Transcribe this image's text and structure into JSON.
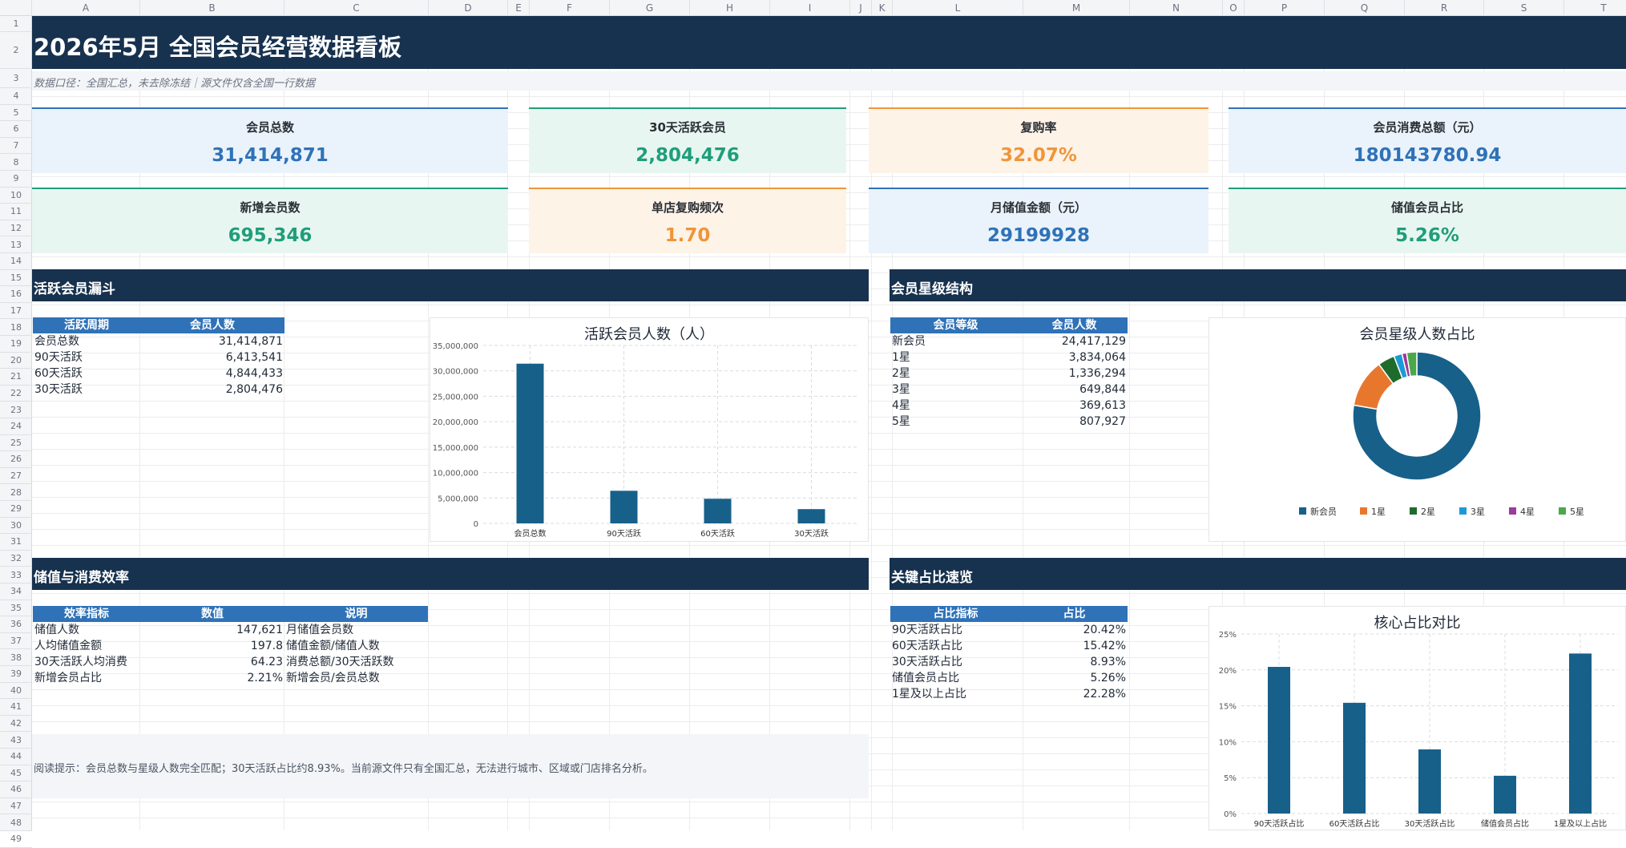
{
  "sheet": {
    "columns": [
      "A",
      "B",
      "C",
      "D",
      "E",
      "F",
      "G",
      "H",
      "I",
      "J",
      "K",
      "L",
      "M",
      "N",
      "O",
      "P",
      "Q",
      "R",
      "S",
      "T"
    ],
    "rows": [
      "1",
      "2",
      "3",
      "4",
      "5",
      "6",
      "7",
      "8",
      "9",
      "10",
      "11",
      "12",
      "13",
      "14",
      "15",
      "16",
      "17",
      "18",
      "19",
      "20",
      "21",
      "22",
      "23",
      "24",
      "25",
      "26",
      "27",
      "28",
      "29",
      "30",
      "31",
      "32",
      "33",
      "34",
      "35",
      "36",
      "37",
      "38",
      "39",
      "40",
      "41",
      "42",
      "43",
      "44",
      "45",
      "46",
      "47",
      "48",
      "49"
    ]
  },
  "title": "2026年5月 全国会员经营数据看板",
  "subtitle": "数据口径：全国汇总，未去除冻结｜源文件仅含全国一行数据",
  "kpis": [
    {
      "label": "会员总数",
      "value": "31,414,871",
      "color": "#2f72b8",
      "bg": "#eaf3fb",
      "bar": "#2f72b8"
    },
    {
      "label": "30天活跃会员",
      "value": "2,804,476",
      "color": "#1f9e7a",
      "bg": "#e8f6f1",
      "bar": "#1f9e7a"
    },
    {
      "label": "复购率",
      "value": "32.07%",
      "color": "#f0953a",
      "bg": "#fef3e7",
      "bar": "#f0953a"
    },
    {
      "label": "会员消费总额（元）",
      "value": "180143780.94",
      "color": "#2f72b8",
      "bg": "#eaf3fb",
      "bar": "#2f72b8"
    },
    {
      "label": "新增会员数",
      "value": "695,346",
      "color": "#1f9e7a",
      "bg": "#e8f6f1",
      "bar": "#1f9e7a"
    },
    {
      "label": "单店复购频次",
      "value": "1.70",
      "color": "#f0953a",
      "bg": "#fef3e7",
      "bar": "#f0953a"
    },
    {
      "label": "月储值金额（元）",
      "value": "29199928",
      "color": "#2f72b8",
      "bg": "#eaf3fb",
      "bar": "#2f72b8"
    },
    {
      "label": "储值会员占比",
      "value": "5.26%",
      "color": "#1f9e7a",
      "bg": "#e8f6f1",
      "bar": "#1f9e7a"
    }
  ],
  "sections": {
    "funnel": "活跃会员漏斗",
    "star": "会员星级结构",
    "efficiency": "储值与消费效率",
    "ratio": "关键占比速览"
  },
  "funnel_table": {
    "headers": [
      "活跃周期",
      "会员人数"
    ],
    "rows": [
      [
        "会员总数",
        "31,414,871"
      ],
      [
        "90天活跃",
        "6,413,541"
      ],
      [
        "60天活跃",
        "4,844,433"
      ],
      [
        "30天活跃",
        "2,804,476"
      ]
    ]
  },
  "star_table": {
    "headers": [
      "会员等级",
      "会员人数"
    ],
    "rows": [
      [
        "新会员",
        "24,417,129"
      ],
      [
        "1星",
        "3,834,064"
      ],
      [
        "2星",
        "1,336,294"
      ],
      [
        "3星",
        "649,844"
      ],
      [
        "4星",
        "369,613"
      ],
      [
        "5星",
        "807,927"
      ]
    ]
  },
  "eff_table": {
    "headers": [
      "效率指标",
      "数值",
      "说明"
    ],
    "rows": [
      [
        "储值人数",
        "147,621",
        "月储值会员数"
      ],
      [
        "人均储值金额",
        "197.8",
        "储值金额/储值人数"
      ],
      [
        "30天活跃人均消费",
        "64.23",
        "消费总额/30天活跃数"
      ],
      [
        "新增会员占比",
        "2.21%",
        "新增会员/会员总数"
      ]
    ]
  },
  "ratio_table": {
    "headers": [
      "占比指标",
      "占比"
    ],
    "rows": [
      [
        "90天活跃占比",
        "20.42%"
      ],
      [
        "60天活跃占比",
        "15.42%"
      ],
      [
        "30天活跃占比",
        "8.93%"
      ],
      [
        "储值会员占比",
        "5.26%"
      ],
      [
        "1星及以上占比",
        "22.28%"
      ]
    ]
  },
  "note": "阅读提示：会员总数与星级人数完全匹配；30天活跃占比约8.93%。当前源文件只有全国汇总，无法进行城市、区域或门店排名分析。",
  "chart_data": [
    {
      "type": "bar",
      "title": "活跃会员人数（人）",
      "categories": [
        "会员总数",
        "90天活跃",
        "60天活跃",
        "30天活跃"
      ],
      "values": [
        31414871,
        6413541,
        4844433,
        2804476
      ],
      "ylim": [
        0,
        35000000
      ],
      "yticks": [
        "0",
        "5,000,000",
        "10,000,000",
        "15,000,000",
        "20,000,000",
        "25,000,000",
        "30,000,000",
        "35,000,000"
      ],
      "color": "#17608a",
      "grid": true
    },
    {
      "type": "pie",
      "title": "会员星级人数占比",
      "categories": [
        "新会员",
        "1星",
        "2星",
        "3星",
        "4星",
        "5星"
      ],
      "values": [
        24417129,
        3834064,
        1336294,
        649844,
        369613,
        807927
      ],
      "colors": [
        "#17608a",
        "#e8772e",
        "#1e6b2c",
        "#1c9ad6",
        "#9b3b9a",
        "#4aa84a"
      ],
      "legend": "bottom"
    },
    {
      "type": "bar",
      "title": "核心占比对比",
      "categories": [
        "90天活跃占比",
        "60天活跃占比",
        "30天活跃占比",
        "储值会员占比",
        "1星及以上占比"
      ],
      "values": [
        20.42,
        15.42,
        8.93,
        5.26,
        22.28
      ],
      "ylim": [
        0,
        25
      ],
      "yticks": [
        "0%",
        "5%",
        "10%",
        "15%",
        "20%",
        "25%"
      ],
      "color": "#17608a",
      "grid": true
    }
  ]
}
